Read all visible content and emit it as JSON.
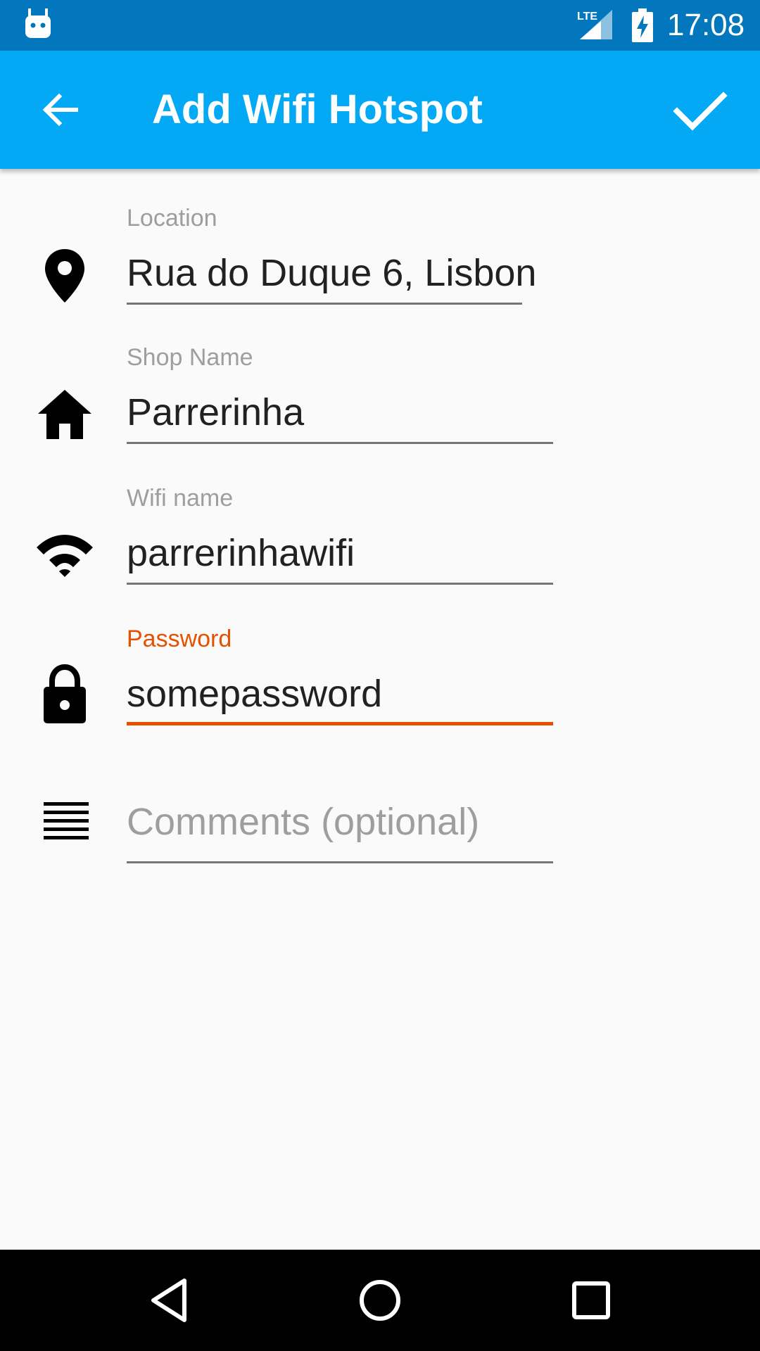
{
  "status_bar": {
    "time": "17:08",
    "network": "LTE",
    "icons": [
      "android-notification-icon",
      "lte-signal-icon",
      "battery-charging-icon"
    ]
  },
  "app_bar": {
    "title": "Add Wifi Hotspot",
    "back_icon": "arrow-back-icon",
    "confirm_icon": "check-icon",
    "color": "#03a9f4"
  },
  "form": {
    "location": {
      "label": "Location",
      "value": "Rua do Duque 6, Lisbon",
      "icon": "location-pin-icon"
    },
    "shop_name": {
      "label": "Shop Name",
      "value": "Parrerinha",
      "icon": "home-icon"
    },
    "wifi_name": {
      "label": "Wifi name",
      "value": "parrerinhawifi",
      "icon": "wifi-icon"
    },
    "password": {
      "label": "Password",
      "value": "somepassword",
      "icon": "lock-icon",
      "focused": true
    },
    "comments": {
      "placeholder": "Comments (optional)",
      "icon": "notes-icon"
    }
  },
  "colors": {
    "status_bar": "#0277bd",
    "accent": "#e65100",
    "background": "#fafafa"
  },
  "nav_bar": {
    "buttons": [
      "back-triangle-icon",
      "home-circle-icon",
      "recents-square-icon"
    ]
  }
}
